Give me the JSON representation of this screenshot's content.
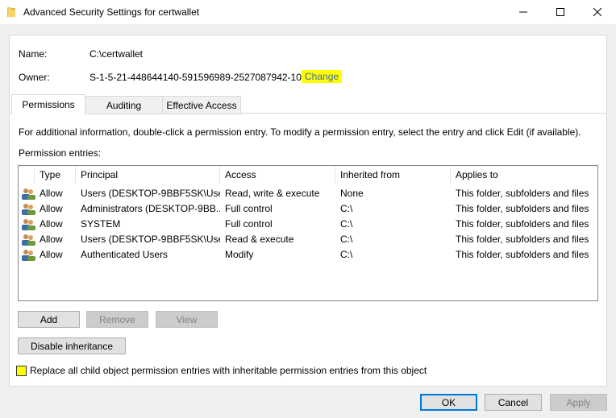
{
  "window": {
    "title": "Advanced Security Settings for certwallet",
    "minimize_icon": "minimize-icon",
    "maximize_icon": "maximize-icon",
    "close_icon": "close-icon"
  },
  "name_label": "Name:",
  "name_value": "C:\\certwallet",
  "owner_label": "Owner:",
  "owner_value": "S-1-5-21-448644140-591596989-2527087942-1062",
  "owner_change_link": "Change",
  "tabs": [
    {
      "label": "Permissions",
      "active": true
    },
    {
      "label": "Auditing",
      "active": false
    },
    {
      "label": "Effective Access",
      "active": false
    }
  ],
  "info_text": "For additional information, double-click a permission entry. To modify a permission entry, select the entry and click Edit (if available).",
  "entries_label": "Permission entries:",
  "columns": [
    "Type",
    "Principal",
    "Access",
    "Inherited from",
    "Applies to"
  ],
  "rows": [
    {
      "type": "Allow",
      "principal": "Users (DESKTOP-9BBF5SK\\Use...",
      "access": "Read, write & execute",
      "inherited": "None",
      "applies": "This folder, subfolders and files"
    },
    {
      "type": "Allow",
      "principal": "Administrators (DESKTOP-9BB...",
      "access": "Full control",
      "inherited": "C:\\",
      "applies": "This folder, subfolders and files"
    },
    {
      "type": "Allow",
      "principal": "SYSTEM",
      "access": "Full control",
      "inherited": "C:\\",
      "applies": "This folder, subfolders and files"
    },
    {
      "type": "Allow",
      "principal": "Users (DESKTOP-9BBF5SK\\Use...",
      "access": "Read & execute",
      "inherited": "C:\\",
      "applies": "This folder, subfolders and files"
    },
    {
      "type": "Allow",
      "principal": "Authenticated Users",
      "access": "Modify",
      "inherited": "C:\\",
      "applies": "This folder, subfolders and files"
    }
  ],
  "buttons": {
    "add": "Add",
    "remove": "Remove",
    "view": "View",
    "disable_inheritance": "Disable inheritance",
    "ok": "OK",
    "cancel": "Cancel",
    "apply": "Apply"
  },
  "replace_checkbox": {
    "label": "Replace all child object permission entries with inheritable permission entries from this object",
    "checked": false
  },
  "colors": {
    "highlight": "#ffff00",
    "link": "#3b6ab8",
    "accent": "#0078d7"
  }
}
